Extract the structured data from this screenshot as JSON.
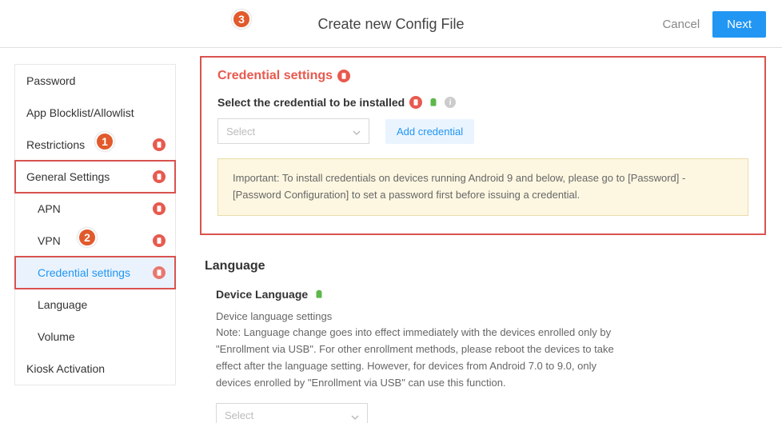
{
  "header": {
    "title": "Create new Config File",
    "cancel": "Cancel",
    "next": "Next"
  },
  "sidebar": {
    "items": [
      {
        "label": "Password"
      },
      {
        "label": "App Blocklist/Allowlist"
      },
      {
        "label": "Restrictions"
      },
      {
        "label": "General Settings"
      },
      {
        "label": "APN"
      },
      {
        "label": "VPN"
      },
      {
        "label": "Credential settings"
      },
      {
        "label": "Language"
      },
      {
        "label": "Volume"
      },
      {
        "label": "Kiosk Activation"
      }
    ]
  },
  "callouts": {
    "c1": "1",
    "c2": "2",
    "c3": "3"
  },
  "credential": {
    "title": "Credential settings",
    "subtitle": "Select the credential to be installed",
    "select_placeholder": "Select",
    "add_label": "Add credential",
    "notice": "Important: To install credentials on devices running Android 9 and below, please go to [Password] - [Password Configuration] to set a password first before issuing a credential."
  },
  "language": {
    "title": "Language",
    "subtitle": "Device Language",
    "desc": "Device language settings",
    "note": "Note: Language change goes into effect immediately with the devices enrolled only by \"Enrollment via USB\". For other enrollment methods, please reboot the devices to take effect after the language setting. However, for devices from Android 7.0 to 9.0, only devices enrolled by \"Enrollment via USB\" can use this function.",
    "select_placeholder": "Select"
  }
}
